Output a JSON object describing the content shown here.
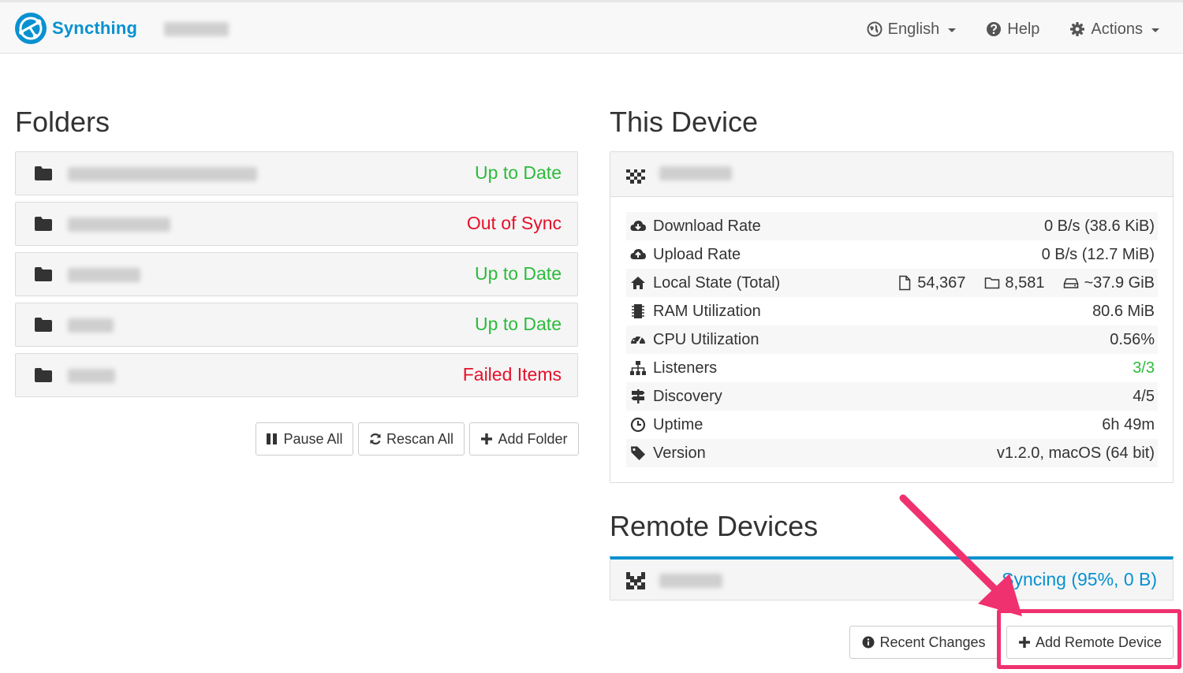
{
  "navbar": {
    "brand": "Syncthing",
    "language": "English",
    "help": "Help",
    "actions": "Actions"
  },
  "folders": {
    "heading": "Folders",
    "items": [
      {
        "status": "Up to Date",
        "state": "ok"
      },
      {
        "status": "Out of Sync",
        "state": "bad"
      },
      {
        "status": "Up to Date",
        "state": "ok"
      },
      {
        "status": "Up to Date",
        "state": "ok"
      },
      {
        "status": "Failed Items",
        "state": "bad"
      }
    ],
    "buttons": {
      "pause_all": "Pause All",
      "rescan_all": "Rescan All",
      "add_folder": "Add Folder"
    }
  },
  "this_device": {
    "heading": "This Device",
    "stats": {
      "download_rate": {
        "label": "Download Rate",
        "value": "0 B/s (38.6 KiB)"
      },
      "upload_rate": {
        "label": "Upload Rate",
        "value": "0 B/s (12.7 MiB)"
      },
      "local_state": {
        "label": "Local State (Total)",
        "files": "54,367",
        "folders": "8,581",
        "size": "~37.9 GiB"
      },
      "ram": {
        "label": "RAM Utilization",
        "value": "80.6 MiB"
      },
      "cpu": {
        "label": "CPU Utilization",
        "value": "0.56%"
      },
      "listeners": {
        "label": "Listeners",
        "value": "3/3"
      },
      "discovery": {
        "label": "Discovery",
        "value": "4/5"
      },
      "uptime": {
        "label": "Uptime",
        "value": "6h 49m"
      },
      "version": {
        "label": "Version",
        "value": "v1.2.0, macOS (64 bit)"
      }
    }
  },
  "remote_devices": {
    "heading": "Remote Devices",
    "items": [
      {
        "status": "Syncing (95%, 0 B)"
      }
    ],
    "buttons": {
      "recent_changes": "Recent Changes",
      "add_remote_device": "Add Remote Device"
    }
  },
  "colors": {
    "brand": "#0891d1",
    "ok": "#2cbb3c",
    "bad": "#e5102a",
    "annotation": "#f0316f"
  }
}
